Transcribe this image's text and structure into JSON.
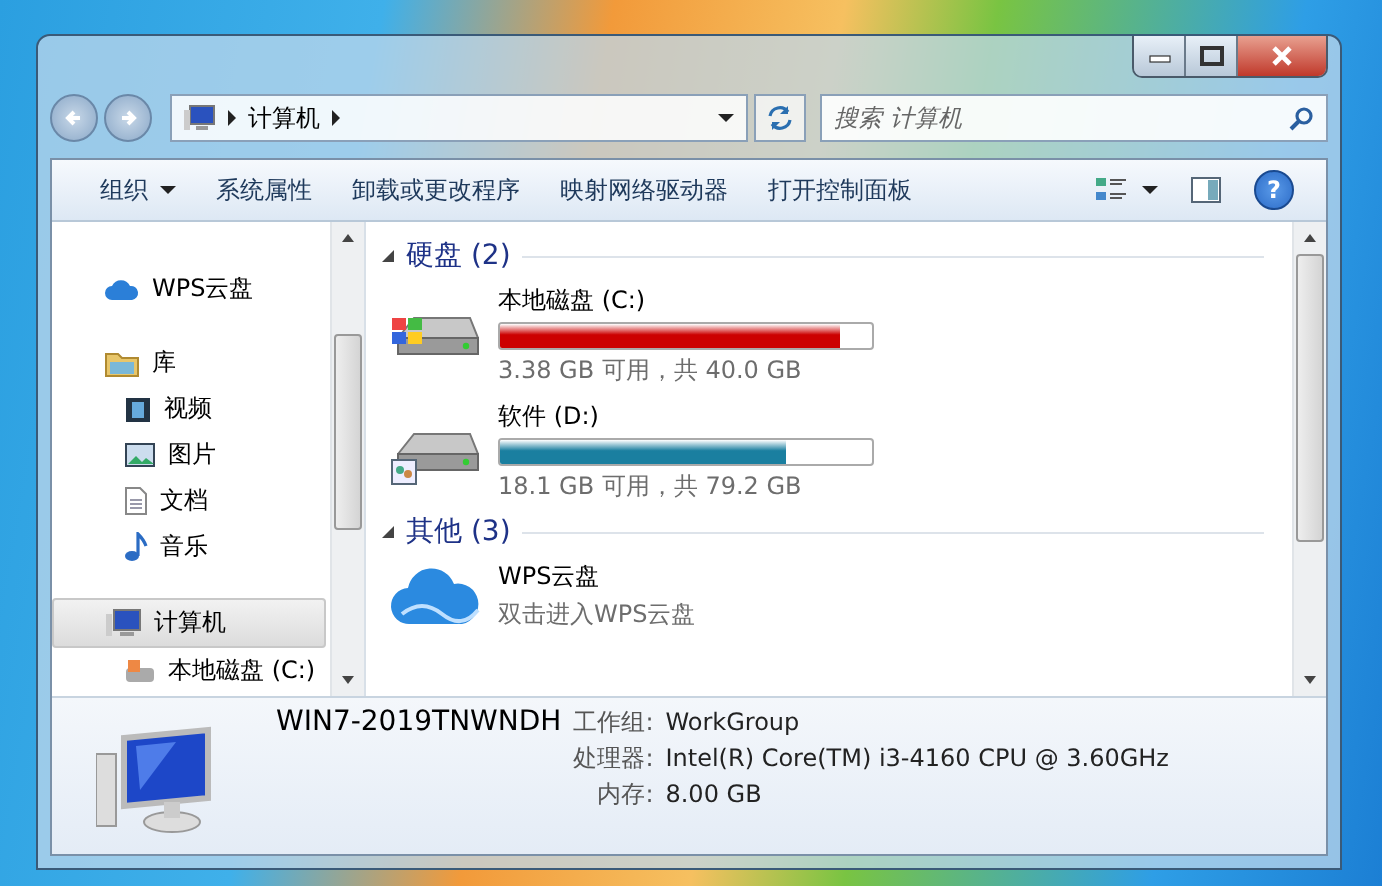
{
  "address": {
    "path": "计算机"
  },
  "search": {
    "placeholder": "搜索 计算机"
  },
  "toolbar": [
    {
      "label": "组织",
      "dropdown": true
    },
    {
      "label": "系统属性",
      "dropdown": false
    },
    {
      "label": "卸载或更改程序",
      "dropdown": false
    },
    {
      "label": "映射网络驱动器",
      "dropdown": false
    },
    {
      "label": "打开控制面板",
      "dropdown": false
    }
  ],
  "help": "?",
  "nav": [
    {
      "label": "WPS云盘",
      "kind": "cloud",
      "selected": false
    },
    {
      "label": "库",
      "kind": "library",
      "selected": false,
      "children": [
        {
          "label": "视频",
          "kind": "video",
          "selected": false
        },
        {
          "label": "图片",
          "kind": "picture",
          "selected": false
        },
        {
          "label": "文档",
          "kind": "document",
          "selected": false
        },
        {
          "label": "音乐",
          "kind": "music",
          "selected": false
        }
      ]
    },
    {
      "label": "计算机",
      "kind": "computer",
      "selected": true,
      "children": [
        {
          "label": "本地磁盘 (C:)",
          "kind": "drive",
          "selected": false
        }
      ]
    }
  ],
  "groups": [
    {
      "title": "硬盘 (2)",
      "expanded": true,
      "items": [
        {
          "kind": "drive",
          "name": "本地磁盘 (C:)",
          "level": 0.915,
          "color": "#cc0000",
          "info": "3.38 GB 可用，共 40.0 GB",
          "system": true
        },
        {
          "kind": "drive",
          "name": "软件 (D:)",
          "level": 0.771,
          "color": "#1a7fa0",
          "info": "18.1 GB 可用，共 79.2 GB",
          "system": false
        }
      ]
    },
    {
      "title": "其他 (3)",
      "expanded": true,
      "items": [
        {
          "kind": "cloud",
          "name": "WPS云盘",
          "info": "双击进入WPS云盘"
        }
      ]
    }
  ],
  "details": {
    "name": "WIN7-2019TNWNDH",
    "fields": [
      {
        "label": "工作组:",
        "value": "WorkGroup"
      },
      {
        "label": "处理器:",
        "value": "Intel(R) Core(TM) i3-4160 CPU @ 3.60GHz"
      },
      {
        "label": "内存:",
        "value": "8.00 GB"
      }
    ]
  }
}
